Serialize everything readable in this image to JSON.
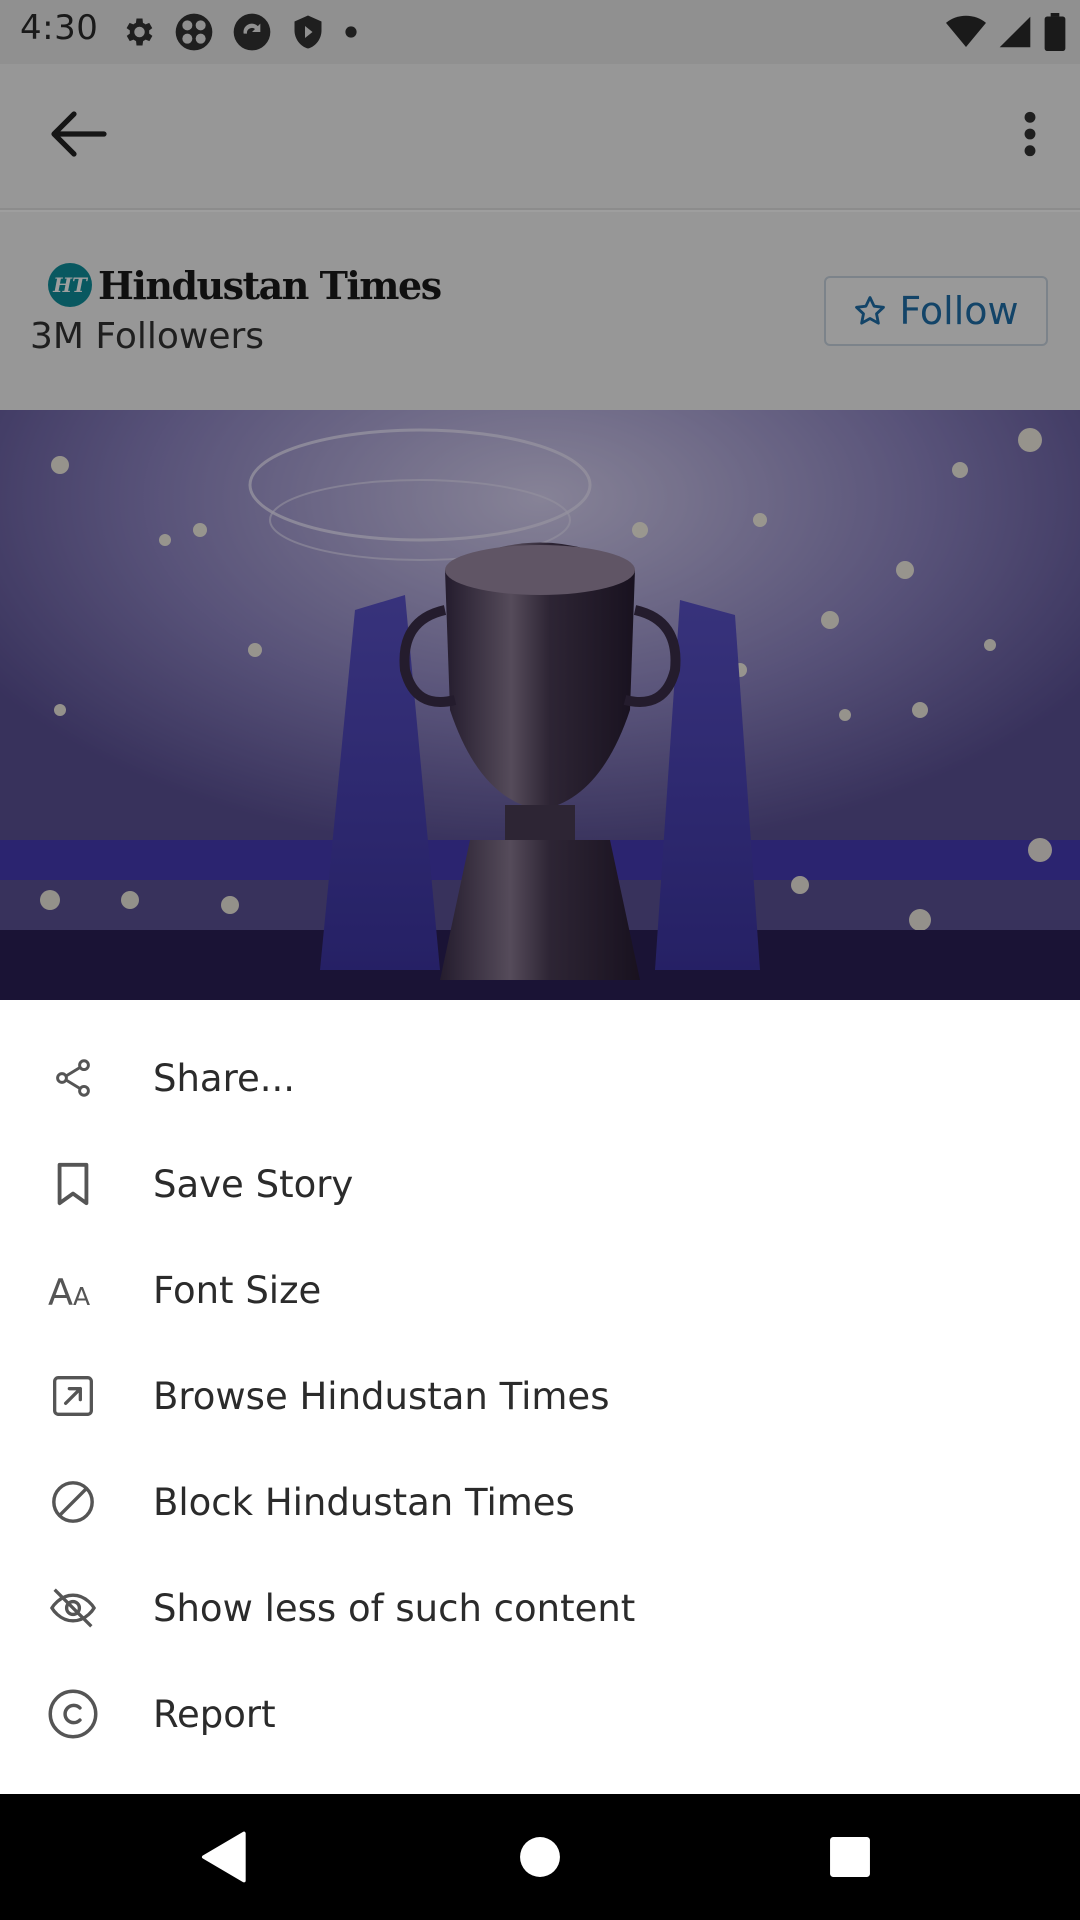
{
  "status_bar": {
    "time": "4:30",
    "left_icons": [
      "settings-icon",
      "pinwheel-app-icon",
      "sync-app-icon",
      "shield-app-icon",
      "dot-icon"
    ],
    "right_icons": [
      "wifi-icon",
      "cellular-signal-icon",
      "battery-icon"
    ]
  },
  "app_bar": {
    "back_icon": "arrow-back-icon",
    "menu_icon": "more-vertical-icon"
  },
  "publisher": {
    "logo_badge": "HT",
    "name": "Hindustan Times",
    "followers": "3M Followers",
    "follow_label": "Follow",
    "follow_icon": "star-outline-icon"
  },
  "article_image": {
    "subject": "trophy-photo"
  },
  "menu": {
    "items": [
      {
        "label": "Share...",
        "icon": "share-icon"
      },
      {
        "label": "Save Story",
        "icon": "bookmark-icon"
      },
      {
        "label": "Font Size",
        "icon": "font-size-icon"
      },
      {
        "label": "Browse Hindustan Times",
        "icon": "open-external-icon"
      },
      {
        "label": "Block Hindustan Times",
        "icon": "block-icon"
      },
      {
        "label": "Show less of such content",
        "icon": "eye-off-icon"
      },
      {
        "label": "Report",
        "icon": "copyright-icon"
      }
    ]
  },
  "nav_bar": {
    "back": "nav-back-icon",
    "home": "nav-home-icon",
    "recents": "nav-recents-icon"
  },
  "colors": {
    "accent": "#1f6ea8",
    "scrim": "#000000",
    "sheet_background": "#ffffff",
    "ht_brand": "#0f8f9c"
  }
}
